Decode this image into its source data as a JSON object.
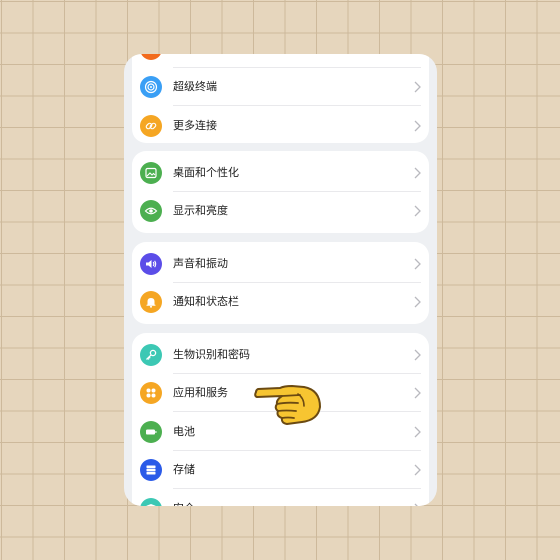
{
  "colors": {
    "connect_icon": "#3a9ff5",
    "more_conn_icon": "#f5a623",
    "desktop_icon": "#4caf50",
    "display_icon": "#4caf50",
    "sound_icon": "#5b4de8",
    "notify_icon": "#f5a623",
    "bio_icon": "#3cc8b4",
    "apps_icon": "#f5a623",
    "battery_icon": "#4caf50",
    "storage_icon": "#2b5be8",
    "security_icon": "#3cc8b4"
  },
  "settings": {
    "group1": {
      "superterminal": "超级终端",
      "more_connections": "更多连接"
    },
    "group2": {
      "desktop": "桌面和个性化",
      "display": "显示和亮度"
    },
    "group3": {
      "sound": "声音和振动",
      "notifications": "通知和状态栏"
    },
    "group4": {
      "biometrics": "生物识别和密码",
      "apps": "应用和服务",
      "battery": "电池",
      "storage": "存储",
      "security": "安全"
    }
  }
}
